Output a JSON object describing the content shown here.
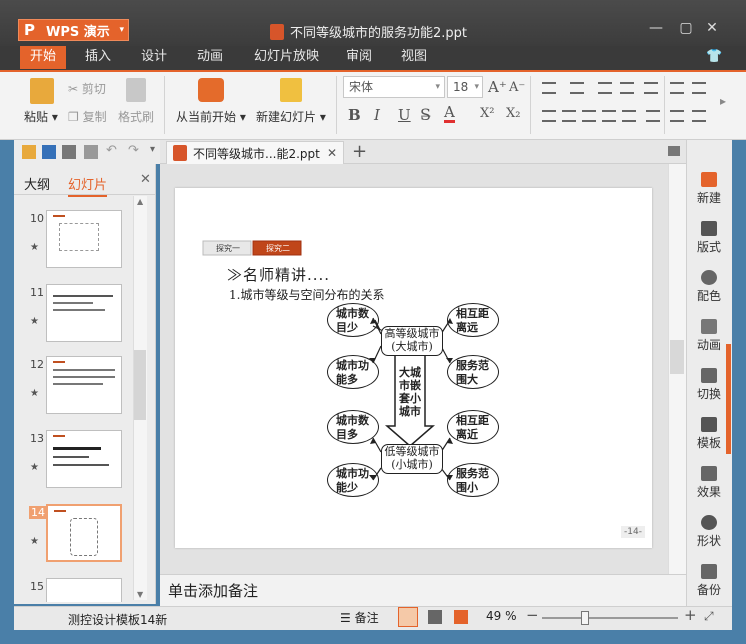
{
  "app": {
    "brand": "WPS 演示",
    "doc_title": "不同等级城市的服务功能2.ppt"
  },
  "menu_tabs": [
    "开始",
    "插入",
    "设计",
    "动画",
    "幻灯片放映",
    "审阅",
    "视图"
  ],
  "ribbon": {
    "paste": "粘贴",
    "cut": "剪切",
    "copy": "复制",
    "format_painter": "格式刷",
    "from_current": "从当前开始",
    "new_slide": "新建幻灯片",
    "font_name": "宋体",
    "font_size": "18",
    "bold": "B",
    "italic": "I",
    "underline": "U",
    "font_color": "A",
    "superscript": "X²",
    "subscript": "X₂"
  },
  "doc_tab": {
    "label": "不同等级城市...能2.ppt",
    "close": "✕",
    "add": "+"
  },
  "left_panel": {
    "tab_outline": "大纲",
    "tab_slides": "幻灯片",
    "close": "✕",
    "slides": [
      {
        "num": "10"
      },
      {
        "num": "11"
      },
      {
        "num": "12"
      },
      {
        "num": "13"
      },
      {
        "num": "14"
      },
      {
        "num": "15"
      }
    ]
  },
  "slide": {
    "tab1": "探究一",
    "tab2": "探究二",
    "heading": "≫名师精讲....",
    "subtitle": "1.城市等级与空间分布的关系",
    "hub_top": [
      "高等级城市",
      "(大城市)"
    ],
    "hub_bottom": [
      "低等级城市",
      "(小城市)"
    ],
    "arrow_text": [
      "大城",
      "市嵌",
      "套小",
      "城市"
    ],
    "ovals": {
      "tl1": [
        "城市数",
        "目少"
      ],
      "tr1": [
        "相互距",
        "离远"
      ],
      "tl2": [
        "城市功",
        "能多"
      ],
      "tr2": [
        "服务范",
        "围大"
      ],
      "tl3": [
        "城市数",
        "目多"
      ],
      "tr3": [
        "相互距",
        "离近"
      ],
      "tl4": [
        "城市功",
        "能少"
      ],
      "tr4": [
        "服务范",
        "围小"
      ]
    },
    "page_num": "-14-"
  },
  "notes_placeholder": "单击添加备注",
  "right_panel": [
    "新建",
    "版式",
    "配色",
    "动画",
    "切换",
    "模板",
    "效果",
    "形状",
    "备份"
  ],
  "status": {
    "template": "测控设计模板14新",
    "notes": "备注",
    "zoom": "49 %",
    "zoom_level": 0.49
  },
  "colors": {
    "accent": "#e4632b",
    "tab2": "#c0461a"
  }
}
